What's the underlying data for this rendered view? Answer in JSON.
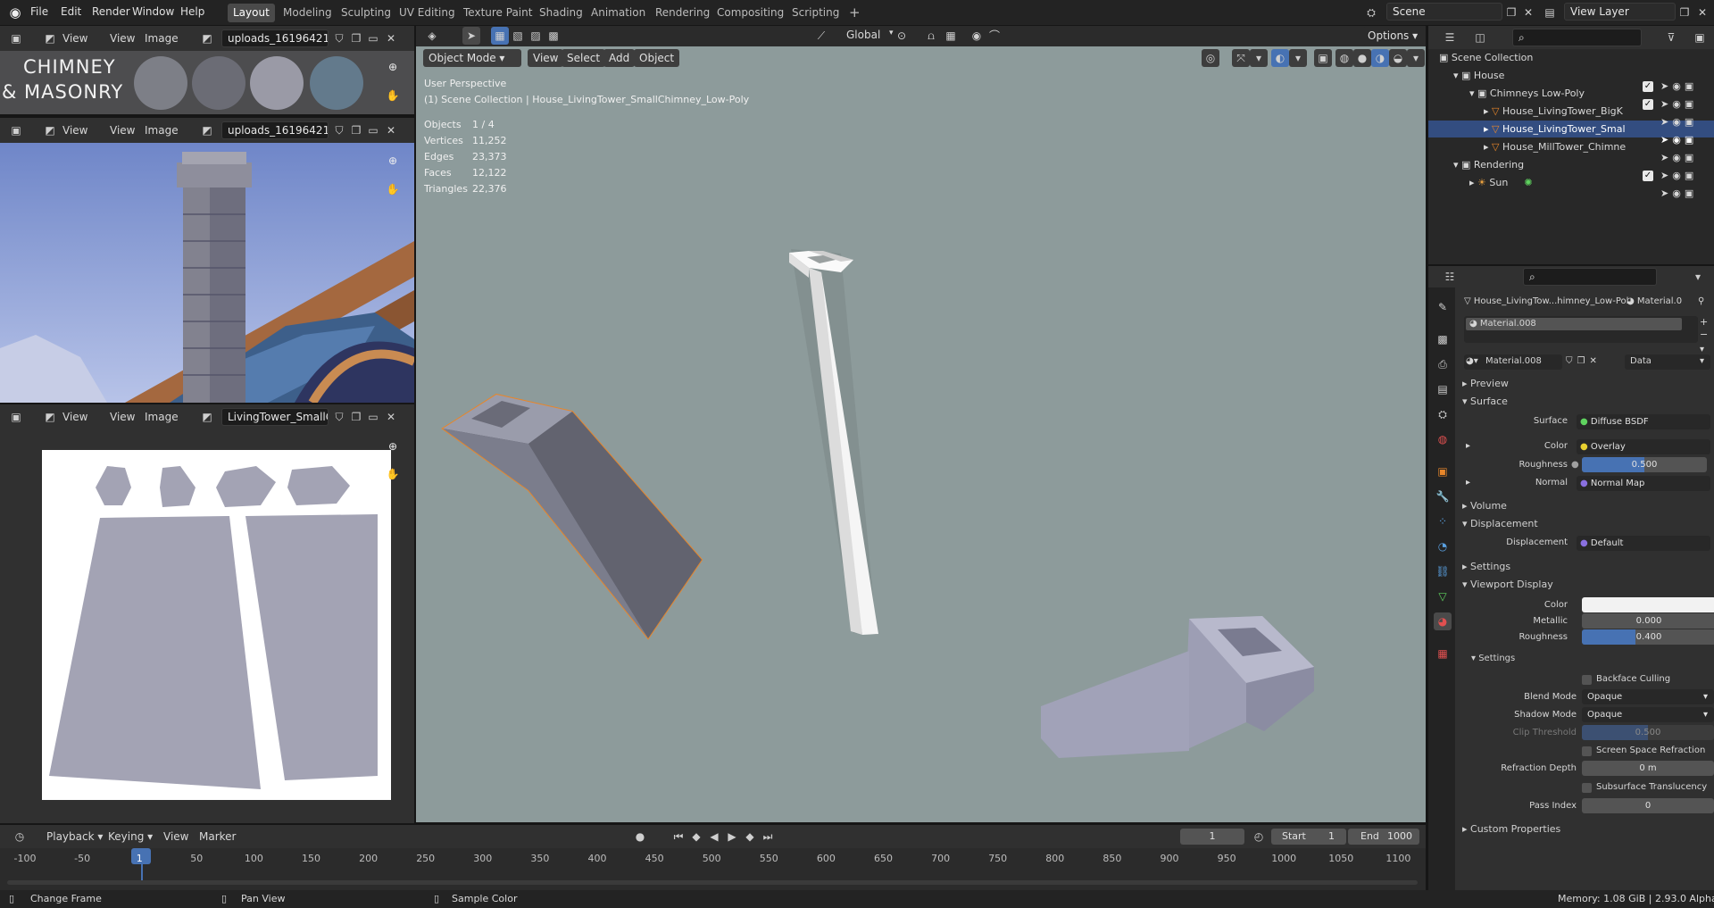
{
  "menu": {
    "file": "File",
    "edit": "Edit",
    "render": "Render",
    "window": "Window",
    "help": "Help"
  },
  "workspaces": [
    "Layout",
    "Modeling",
    "Sculpting",
    "UV Editing",
    "Texture Paint",
    "Shading",
    "Animation",
    "Rendering",
    "Compositing",
    "Scripting"
  ],
  "scene": {
    "name": "Scene",
    "view_layer": "View Layer"
  },
  "image_editor_1": {
    "view": "View",
    "view2": "View",
    "image": "Image",
    "filename": "uploads_16196421...",
    "title_line1": "CHIMNEY",
    "title_line2": "& MASONRY"
  },
  "image_editor_2": {
    "view": "View",
    "view2": "View",
    "image": "Image",
    "filename": "uploads_16196421..."
  },
  "uv_editor": {
    "view": "View",
    "view2": "View",
    "image": "Image",
    "filename": "LivingTower_SmallC..."
  },
  "viewport": {
    "mode": "Object Mode",
    "view": "View",
    "select": "Select",
    "add": "Add",
    "object": "Object",
    "transform": "Global",
    "options": "Options",
    "perspective": "User Perspective",
    "collection_path": "(1) Scene Collection | House_LivingTower_SmallChimney_Low-Poly",
    "stats": [
      {
        "label": "Objects",
        "value": "1 / 4"
      },
      {
        "label": "Vertices",
        "value": "11,252"
      },
      {
        "label": "Edges",
        "value": "23,373"
      },
      {
        "label": "Faces",
        "value": "12,122"
      },
      {
        "label": "Triangles",
        "value": "22,376"
      }
    ]
  },
  "outliner": {
    "scene_collection": "Scene Collection",
    "house": "House",
    "chimneys": "Chimneys Low-Poly",
    "obj1": "House_LivingTower_BigK",
    "obj2": "House_LivingTower_Smal",
    "obj3": "House_MillTower_Chimne",
    "rendering": "Rendering",
    "sun": "Sun"
  },
  "properties": {
    "object_name": "House_LivingTow...himney_Low-Pol",
    "material_tab": "Material.0",
    "slot": "Material.008",
    "material_name": "Material.008",
    "data": "Data",
    "preview": "Preview",
    "surface_section": "Surface",
    "surface_label": "Surface",
    "surface_value": "Diffuse BSDF",
    "color_label": "Color",
    "color_value": "Overlay",
    "roughness_label": "Roughness",
    "roughness_value": "0.500",
    "normal_label": "Normal",
    "normal_value": "Normal Map",
    "volume": "Volume",
    "displacement_section": "Displacement",
    "displacement_label": "Displacement",
    "displacement_value": "Default",
    "settings": "Settings",
    "viewport_display": "Viewport Display",
    "vd_color": "Color",
    "vd_metallic": "Metallic",
    "vd_metallic_value": "0.000",
    "vd_roughness": "Roughness",
    "vd_roughness_value": "0.400",
    "vd_settings": "Settings",
    "backface": "Backface Culling",
    "blend_mode": "Blend Mode",
    "blend_value": "Opaque",
    "shadow_mode": "Shadow Mode",
    "shadow_value": "Opaque",
    "clip": "Clip Threshold",
    "clip_value": "0.500",
    "ssr": "Screen Space Refraction",
    "refraction_depth": "Refraction Depth",
    "refraction_value": "0 m",
    "sss": "Subsurface Translucency",
    "pass_index": "Pass Index",
    "pass_value": "0",
    "custom_props": "Custom Properties",
    "roughness_fill": 0.5,
    "vd_roughness_fill": 0.4,
    "clip_fill": 0.5
  },
  "timeline": {
    "playback": "Playback",
    "keying": "Keying",
    "view": "View",
    "marker": "Marker",
    "current": "1",
    "start_label": "Start",
    "start": "1",
    "end_label": "End",
    "end": "1000",
    "ticks": [
      "-100",
      "-50",
      "1",
      "50",
      "100",
      "150",
      "200",
      "250",
      "300",
      "350",
      "400",
      "450",
      "500",
      "550",
      "600",
      "650",
      "700",
      "750",
      "800",
      "850",
      "900",
      "950",
      "1000",
      "1050",
      "1100"
    ]
  },
  "status": {
    "change_frame": "Change Frame",
    "pan_view": "Pan View",
    "sample_color": "Sample Color",
    "memory": "Memory: 1.08 GiB | 2.93.0 Alpha"
  },
  "colors": {
    "accent": "#4772b3",
    "selection": "#e8862a",
    "viewport_bg": "#8d9b9b",
    "swatch1": "#7d7f87",
    "swatch2": "#6b6c75",
    "swatch3": "#9a9aa6",
    "swatch4": "#637a8c",
    "uv_island": "#a3a3b4"
  }
}
